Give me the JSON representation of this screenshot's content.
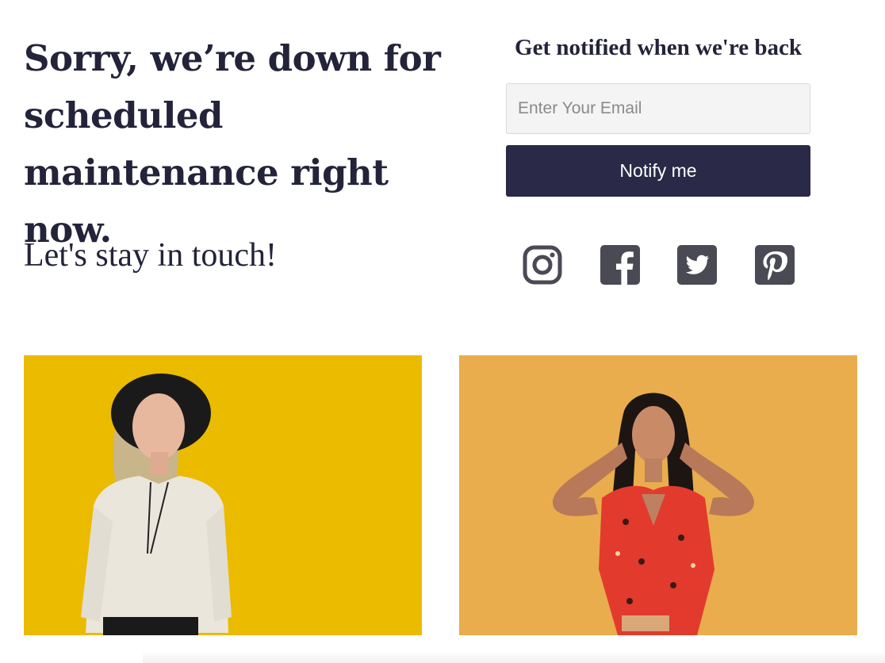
{
  "headline": "Sorry, we’re down for scheduled maintenance right now.",
  "notify": {
    "title": "Get notified when we're back",
    "email_placeholder": "Enter Your Email",
    "email_value": "",
    "button_label": "Notify me"
  },
  "stay_in_touch": "Let's stay in touch!",
  "social_links": [
    {
      "icon": "instagram-icon"
    },
    {
      "icon": "facebook-icon"
    },
    {
      "icon": "twitter-icon"
    },
    {
      "icon": "pinterest-icon"
    }
  ],
  "colors": {
    "text": "#23233a",
    "button": "#2a2947",
    "icon": "#4a4a55",
    "photo_left_bg": "#e8b800",
    "photo_right_bg": "#e9ad4d"
  }
}
